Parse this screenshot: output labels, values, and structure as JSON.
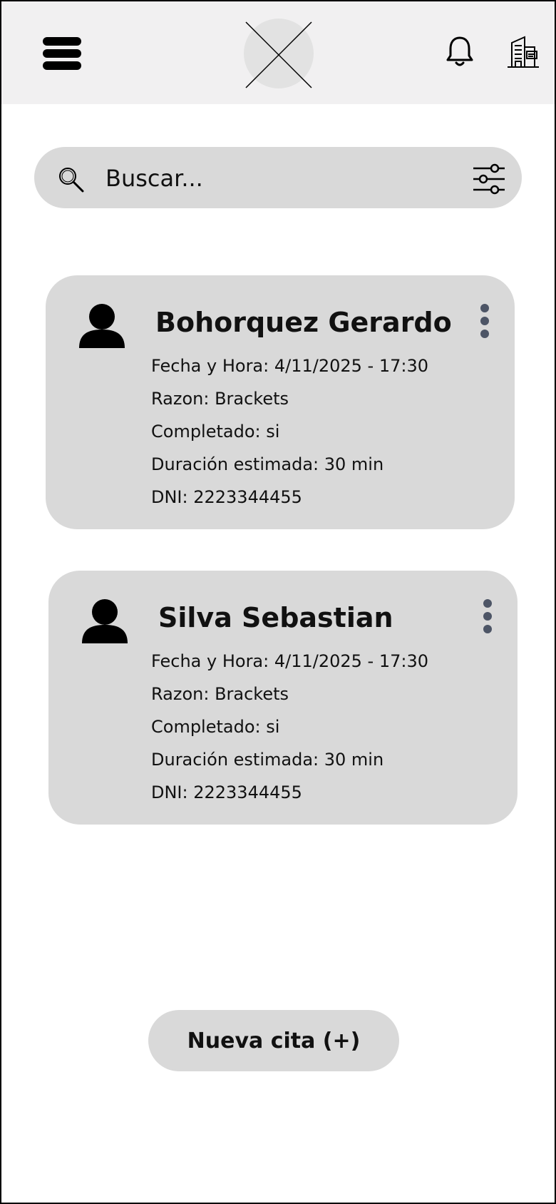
{
  "header": {
    "menu_icon": "hamburger-menu-icon",
    "logo": "placeholder-logo",
    "notifications_icon": "bell-icon",
    "clinic_icon": "building-icon"
  },
  "search": {
    "placeholder": "Buscar...",
    "value": "",
    "icon": "magnifier-icon",
    "filter_icon": "sliders-filter-icon"
  },
  "appointments": [
    {
      "name": "Bohorquez Gerardo",
      "fecha": "Fecha y Hora:  4/11/2025 - 17:30",
      "razon": "Razon: Brackets",
      "completado": "Completado: si",
      "duracion": "Duración estimada: 30 min",
      "dni": "DNI: 2223344455"
    },
    {
      "name": "Silva Sebastian",
      "fecha": "Fecha y Hora:  4/11/2025 - 17:30",
      "razon": "Razon: Brackets",
      "completado": "Completado: si",
      "duracion": "Duración estimada: 30 min",
      "dni": "DNI: 2223344455"
    }
  ],
  "actions": {
    "new_appointment": "Nueva cita (+)"
  },
  "colors": {
    "topbar": "#f1f0f1",
    "card": "#d9d9d9",
    "kebab": "#4d5566"
  }
}
